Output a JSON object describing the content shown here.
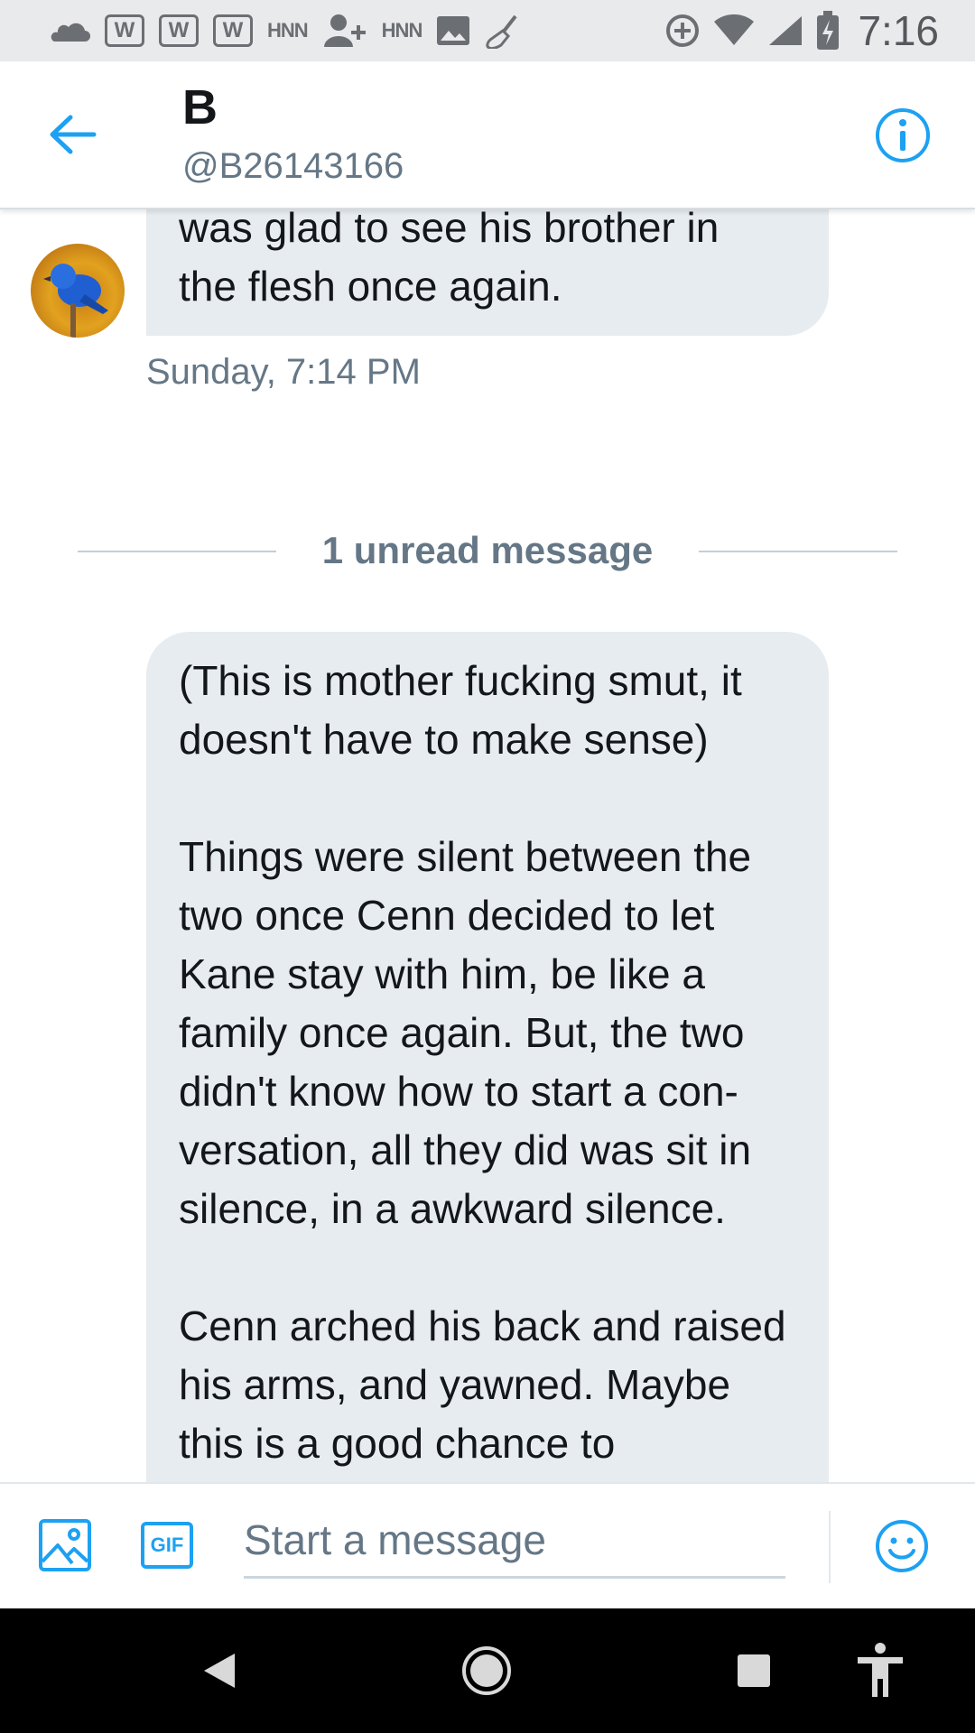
{
  "status_bar": {
    "time": "7:16",
    "hnn_label_1": "HNN",
    "hnn_label_2": "HNN",
    "box_label": "W"
  },
  "header": {
    "name": "B",
    "handle": "@B26143166"
  },
  "conversation": {
    "first_message_lines": [
      "was glad to see his brother in",
      "the flesh once again."
    ],
    "timestamp": "Sunday, 7:14 PM",
    "unread_divider": "1 unread message",
    "unread_message_paragraphs": [
      "(This is mother fucking smut, it doesn't have to make sense)",
      "Things were silent between the two once Cenn decided to let Kane stay with him, be like a family once again. But, the two didn't know how to start a con-versation, all they did was sit in silence, in a awkward silence.",
      "Cenn arched his back and raised his arms, and yawned. Maybe this is a good chance to"
    ]
  },
  "composer": {
    "placeholder": "Start a message",
    "gif_label": "GIF"
  },
  "colors": {
    "accent": "#1da1f2",
    "bubble": "#e6ecf0",
    "secondary_text": "#657786"
  }
}
